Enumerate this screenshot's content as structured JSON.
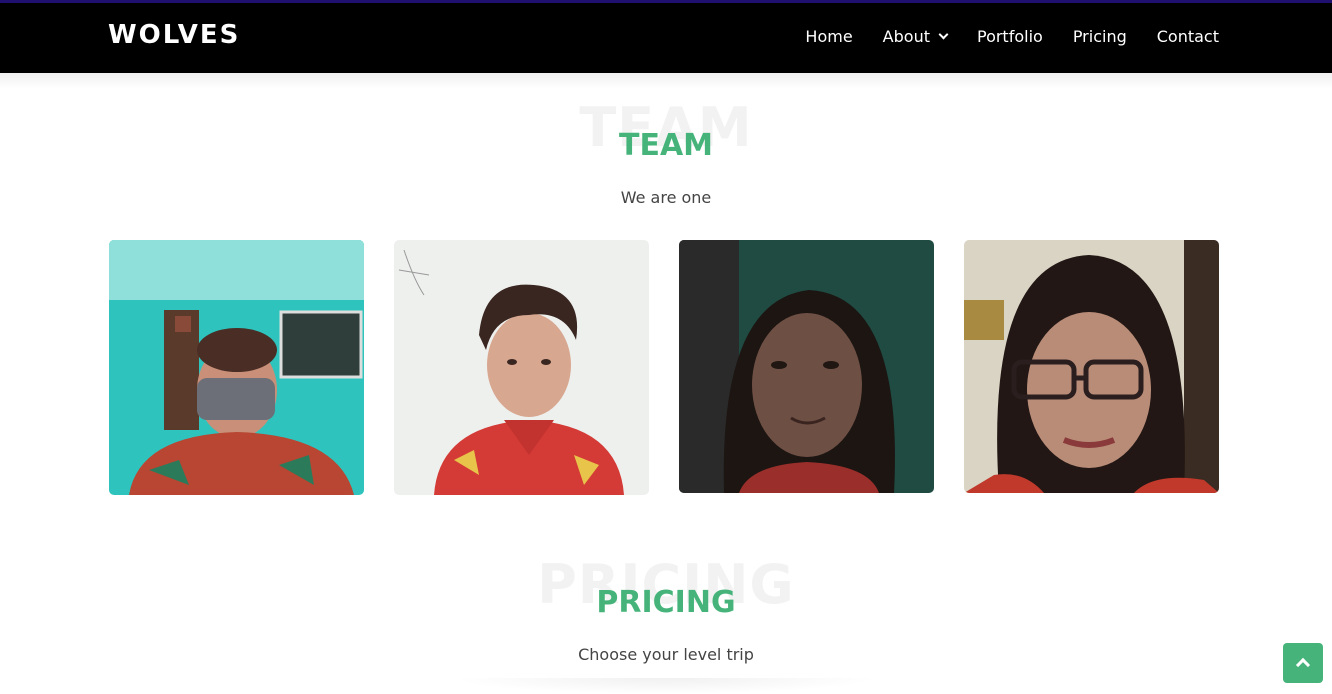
{
  "header": {
    "logo": "WOLVES",
    "nav": [
      {
        "label": "Home"
      },
      {
        "label": "About"
      },
      {
        "label": "Portfolio"
      },
      {
        "label": "Pricing"
      },
      {
        "label": "Contact"
      }
    ]
  },
  "team": {
    "bg_title": "TEAM",
    "title": "TEAM",
    "subtitle": "We are one",
    "members": [
      {
        "photo": "member-1-photo"
      },
      {
        "photo": "member-2-photo"
      },
      {
        "photo": "member-3-photo"
      },
      {
        "photo": "member-4-photo"
      }
    ]
  },
  "pricing": {
    "bg_title": "PRICING",
    "title": "PRICING",
    "subtitle": "Choose your level trip"
  },
  "colors": {
    "accent": "#46b47a",
    "header_bg": "#000000",
    "top_line": "#1f0f6e"
  },
  "back_to_top": {
    "icon": "chevron-up-icon"
  }
}
